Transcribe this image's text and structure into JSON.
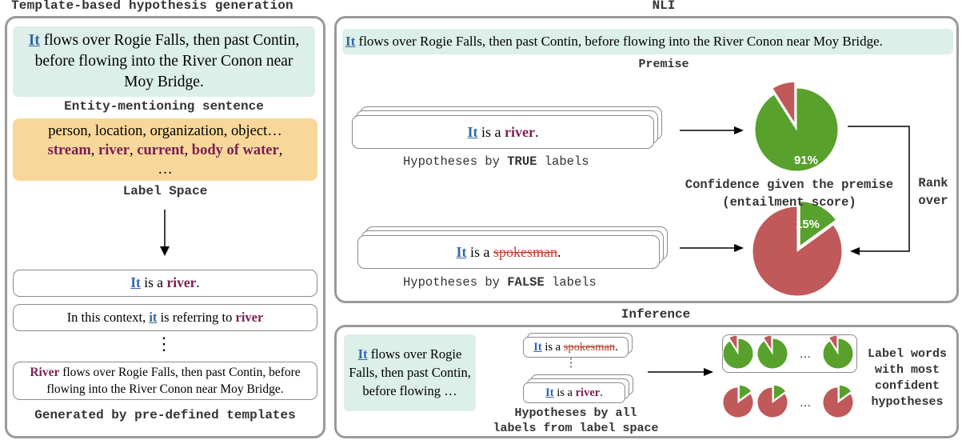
{
  "left": {
    "title": "Template-based hypothesis generation",
    "sentence": {
      "pronoun": "It",
      "rest": " flows over Rogie Falls, then past Contin, before flowing into the River Conon near Moy Bridge."
    },
    "sentence_caption": "Entity-mentioning sentence",
    "label_space": {
      "line1": "person, location, organization, object…",
      "labels": [
        "stream",
        "river",
        "current",
        "body of water"
      ],
      "ellipsis": "…"
    },
    "label_space_caption": "Label Space",
    "templates": {
      "t1": {
        "pronoun": "It",
        "middle": " is a ",
        "label": "river",
        "end": "."
      },
      "t2": {
        "prefix": "In this context, ",
        "pronoun": "it",
        "middle": " is referring to ",
        "label": "river"
      },
      "vdots": "⋮",
      "t3": {
        "label": "River",
        "rest": " flows over Rogie Falls, then past Contin, before flowing into the River Conon near Moy Bridge."
      }
    },
    "caption": "Generated by pre-defined templates"
  },
  "nli": {
    "title": "NLI",
    "premise": {
      "pronoun": "It",
      "rest": " flows over Rogie Falls, then past Contin, before flowing into the River Conon near Moy Bridge."
    },
    "premise_caption": "Premise",
    "true_hyp": {
      "pronoun": "It",
      "middle": " is a ",
      "label": "river",
      "end": "."
    },
    "true_caption_pre": "Hypotheses by ",
    "true_caption_key": "TRUE",
    "true_caption_post": " labels",
    "false_hyp": {
      "pronoun": "It",
      "middle": " is a ",
      "label": "spokesman",
      "end": "."
    },
    "false_caption_pre": "Hypotheses by ",
    "false_caption_key": "FALSE",
    "false_caption_post": " labels",
    "confidence_line1": "Confidence given the premise",
    "confidence_line2": "(entailment score)",
    "rank_line1": "Rank",
    "rank_line2": "over",
    "pie_true_pct": "91%",
    "pie_false_pct": "15%",
    "pie_true_value": 0.91,
    "pie_false_value": 0.15
  },
  "inference": {
    "title": "Inference",
    "premise": {
      "pronoun": "It",
      "rest": " flows over Rogie Falls, then past Contin, before flowing …"
    },
    "hyp_false": {
      "pronoun": "It",
      "middle": " is a ",
      "label": "spokesman",
      "end": "."
    },
    "hyp_true": {
      "pronoun": "It",
      "middle": " is a ",
      "label": "river",
      "end": "."
    },
    "vdots": "⋮",
    "hyp_caption_line1": "Hypotheses by all",
    "hyp_caption_line2": "labels from label space",
    "dots": "…",
    "result_line1": "Label words",
    "result_line2": "with most",
    "result_line3": "confident",
    "result_line4": "hypotheses"
  },
  "colors": {
    "pie_green": "#57a12c",
    "pie_red": "#c0595a",
    "premise_bg": "#dcefe8",
    "label_space_bg": "#f8d89a",
    "label_color": "#7a1f52",
    "pronoun_color": "#3366aa"
  }
}
